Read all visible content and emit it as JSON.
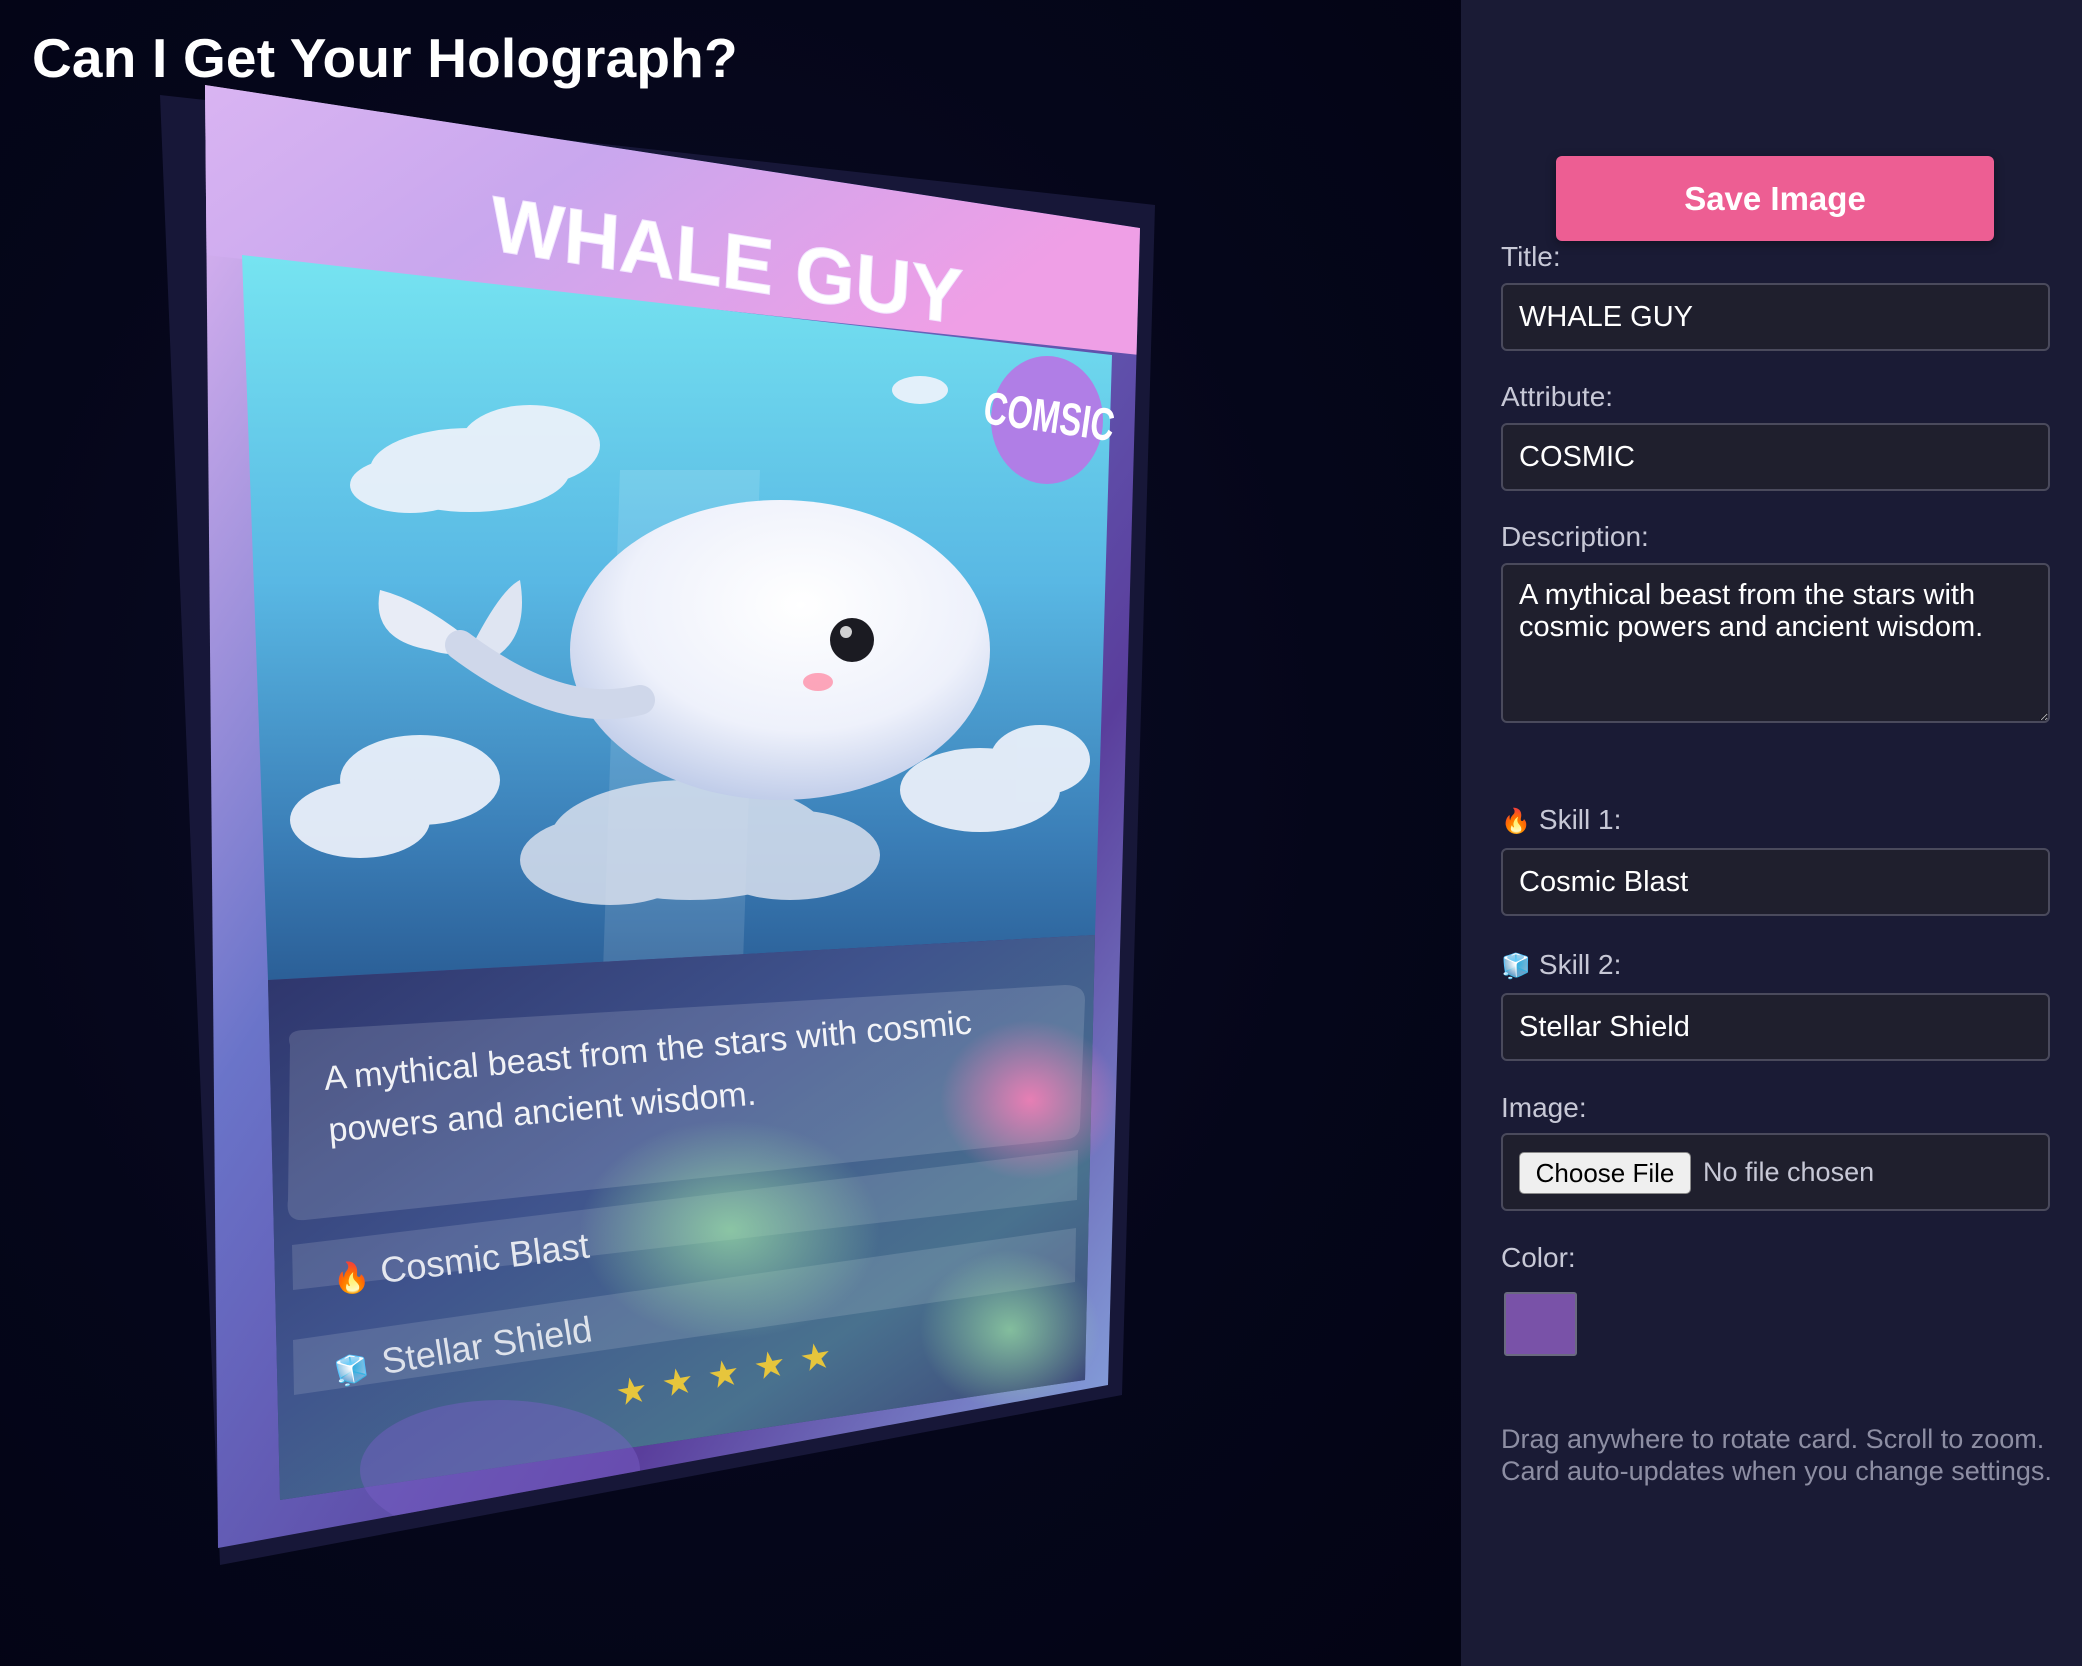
{
  "app": {
    "title": "Can I Get Your Holograph?"
  },
  "card": {
    "title": "WHALE GUY",
    "attribute": "COMSIC",
    "description_lines": [
      "A mythical beast from the stars with cosmic",
      "powers and ancient wisdom."
    ],
    "skill1": "Cosmic Blast",
    "skill2": "Stellar Shield",
    "stars": [
      "★",
      "★",
      "★",
      "★",
      "★"
    ],
    "icons": {
      "skill1": "fire-icon",
      "skill2": "ice-cube-icon",
      "badge": "attribute-badge"
    }
  },
  "panel": {
    "save_label": "Save Image",
    "title_label": "Title:",
    "title_value": "WHALE GUY",
    "attribute_label": "Attribute:",
    "attribute_value": "COSMIC",
    "description_label": "Description:",
    "description_value": "A mythical beast from the stars with cosmic powers and ancient wisdom.",
    "skill1_label": "Skill 1:",
    "skill1_icon": "🔥",
    "skill1_value": "Cosmic Blast",
    "skill2_label": "Skill 2:",
    "skill2_icon": "🧊",
    "skill2_value": "Stellar Shield",
    "image_label": "Image:",
    "choose_file_label": "Choose File",
    "file_status": "No file chosen",
    "color_label": "Color:",
    "color_value": "#7952a8",
    "hint": "Drag anywhere to rotate card. Scroll to zoom. Card auto-updates when you change settings."
  },
  "colors": {
    "accent": "#ed5e93",
    "panel_bg": "#1a1b35",
    "stage_bg": "#05061a",
    "badge": "#b07ee6"
  }
}
